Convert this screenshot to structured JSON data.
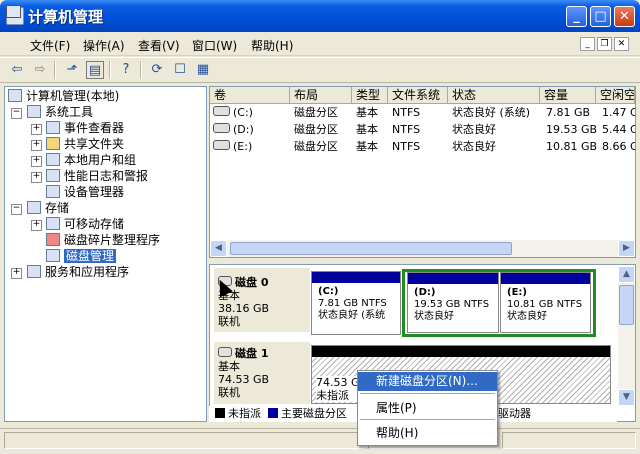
{
  "window": {
    "title": "计算机管理",
    "btn_min": "_",
    "btn_max": "□",
    "btn_close": "✕"
  },
  "menu": {
    "items": [
      "文件(F)",
      "操作(A)",
      "查看(V)",
      "窗口(W)",
      "帮助(H)"
    ],
    "mdi_min": "_",
    "mdi_restore": "❐",
    "mdi_close": "✕"
  },
  "toolbar": {
    "back": "⇦",
    "forward": "⇨",
    "up": "⬏",
    "show_tree": "▤",
    "help": "?",
    "refresh": "⟳",
    "properties": "☐",
    "export": "▦"
  },
  "tree": {
    "root": "计算机管理(本地)",
    "system_tools": "系统工具",
    "event_viewer": "事件查看器",
    "shared_folders": "共享文件夹",
    "local_users": "本地用户和组",
    "perf_logs": "性能日志和警报",
    "device_manager": "设备管理器",
    "storage": "存储",
    "removable": "可移动存储",
    "defrag": "磁盘碎片整理程序",
    "disk_mgmt": "磁盘管理",
    "services": "服务和应用程序"
  },
  "list": {
    "columns": [
      "卷",
      "布局",
      "类型",
      "文件系统",
      "状态",
      "容量",
      "空闲空"
    ],
    "rows": [
      [
        "(C:)",
        "磁盘分区",
        "基本",
        "NTFS",
        "状态良好 (系统)",
        "7.81 GB",
        "1.47 G"
      ],
      [
        "(D:)",
        "磁盘分区",
        "基本",
        "NTFS",
        "状态良好",
        "19.53 GB",
        "5.44 G"
      ],
      [
        "(E:)",
        "磁盘分区",
        "基本",
        "NTFS",
        "状态良好",
        "10.81 GB",
        "8.66 G"
      ]
    ]
  },
  "disks": [
    {
      "name": "磁盘 0",
      "type": "基本",
      "size": "38.16 GB",
      "status": "联机",
      "volumes": [
        {
          "label": "(C:)",
          "size": "7.81 GB NTFS",
          "status": "状态良好 (系统"
        },
        {
          "label": "(D:)",
          "size": "19.53 GB NTFS",
          "status": "状态良好"
        },
        {
          "label": "(E:)",
          "size": "10.81 GB NTFS",
          "status": "状态良好"
        }
      ]
    },
    {
      "name": "磁盘 1",
      "type": "基本",
      "size": "74.53 GB",
      "status": "联机",
      "volumes": [
        {
          "size": "74.53 G",
          "status": "未指派"
        }
      ]
    }
  ],
  "legend": {
    "unallocated": "未指派",
    "primary": "主要磁盘分区",
    "tail": "驱动器"
  },
  "context_menu": {
    "new_partition": "新建磁盘分区(N)...",
    "properties": "属性(P)",
    "help": "帮助(H)"
  },
  "colors": {
    "title_bar": "#0050d8",
    "volume_header": "#00009c",
    "selection": "#316ac5",
    "selected_volume_border": "#228b22"
  }
}
